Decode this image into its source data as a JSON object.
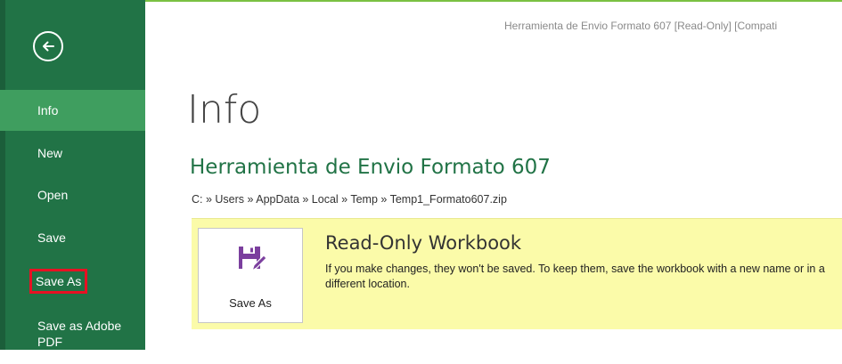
{
  "window": {
    "title": "Herramienta de Envio Formato 607  [Read-Only]  [Compati"
  },
  "sidebar": {
    "back_icon": "back-arrow-icon",
    "items": [
      {
        "label": "Info",
        "active": true
      },
      {
        "label": "New"
      },
      {
        "label": "Open"
      },
      {
        "label": "Save"
      },
      {
        "label": "Save As",
        "highlighted": true
      },
      {
        "label": "Save as Adobe PDF"
      }
    ]
  },
  "main": {
    "page_title": "Info",
    "document_name": "Herramienta de Envio Formato 607",
    "path": "C: » Users » AppData » Local » Temp » Temp1_Formato607.zip"
  },
  "readonly_panel": {
    "tile_icon": "save-as-icon",
    "tile_label": "Save As",
    "title": "Read-Only Workbook",
    "description": "If you make changes, they won't be saved. To keep them, save the workbook with a new name or in a different location."
  },
  "colors": {
    "sidebar_bg": "#217346",
    "sidebar_active": "#3f9e5f",
    "accent_green": "#217346",
    "panel_bg": "#fbfba9",
    "highlight_outline": "#e81123",
    "icon_purple": "#7b3f9e"
  }
}
